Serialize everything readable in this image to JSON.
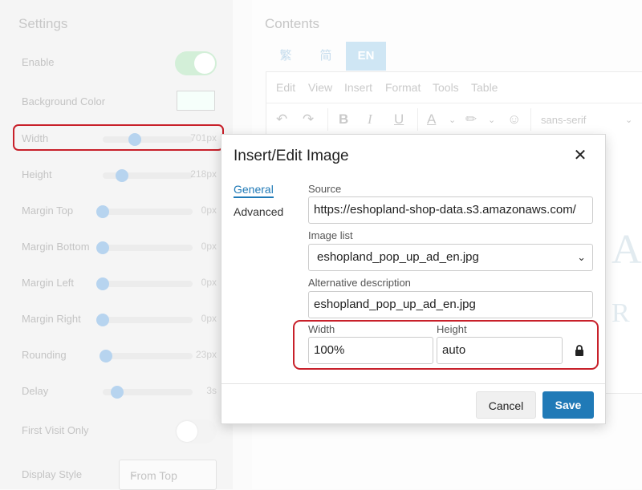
{
  "settings": {
    "title": "Settings",
    "enable": {
      "label": "Enable",
      "on": true
    },
    "background_color": {
      "label": "Background Color",
      "value": "#f6fffb"
    },
    "sliders": [
      {
        "key": "width",
        "label": "Width",
        "value": "701px",
        "level": 0.36
      },
      {
        "key": "height",
        "label": "Height",
        "value": "218px",
        "level": 0.21
      },
      {
        "key": "margin_top",
        "label": "Margin Top",
        "value": "0px",
        "level": 0.0
      },
      {
        "key": "margin_bottom",
        "label": "Margin Bottom",
        "value": "0px",
        "level": 0.0
      },
      {
        "key": "margin_left",
        "label": "Margin Left",
        "value": "0px",
        "level": 0.0
      },
      {
        "key": "margin_right",
        "label": "Margin Right",
        "value": "0px",
        "level": 0.0
      },
      {
        "key": "rounding",
        "label": "Rounding",
        "value": "23px",
        "level": 0.04
      },
      {
        "key": "delay",
        "label": "Delay",
        "value": "3s",
        "level": 0.16
      }
    ],
    "first_visit_only": {
      "label": "First Visit Only",
      "on": false
    },
    "display_style": {
      "label": "Display Style",
      "value": "From Top"
    }
  },
  "contents": {
    "title": "Contents",
    "lang_tabs": [
      "繁",
      "简",
      "EN"
    ],
    "active_lang": "EN",
    "menu": [
      "Edit",
      "View",
      "Insert",
      "Format",
      "Tools",
      "Table"
    ],
    "font": "sans-serif"
  },
  "dialog": {
    "title": "Insert/Edit Image",
    "tabs": [
      "General",
      "Advanced"
    ],
    "source": {
      "label": "Source",
      "value": "https://eshopland-shop-data.s3.amazonaws.com/"
    },
    "image_list": {
      "label": "Image list",
      "value": "eshopland_pop_up_ad_en.jpg"
    },
    "alt": {
      "label": "Alternative description",
      "value": "eshopland_pop_up_ad_en.jpg"
    },
    "width": {
      "label": "Width",
      "value": "100%"
    },
    "height": {
      "label": "Height",
      "value": "auto"
    },
    "cancel": "Cancel",
    "save": "Save"
  },
  "colors": {
    "accent": "#207ab7",
    "highlight": "#c8202a",
    "toggle_on": "#d3efd8"
  }
}
